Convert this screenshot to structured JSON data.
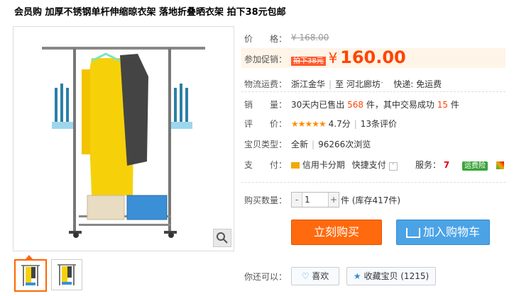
{
  "title": "会员购 加厚不锈钢单杆伸缩晾衣架 落地折叠晒衣架 拍下38元包邮",
  "price": {
    "label": "价　　格：",
    "original": "¥ 168.00"
  },
  "promo": {
    "label": "参加促销：",
    "tag": "拍下38元",
    "yen": "¥",
    "amount": "160.00"
  },
  "shipping": {
    "label": "物流运费：",
    "from": "浙江金华",
    "to_prefix": "至",
    "to": "河北廊坊",
    "fee": "快递: 免运费"
  },
  "sales": {
    "label": "销　　量：",
    "pre": "30天内已售出",
    "count": "568",
    "mid": "件，其中交易成功",
    "success": "15",
    "post": "件"
  },
  "rating": {
    "label": "评　　价：",
    "stars": "★★★★★",
    "score": "4.7分",
    "reviews": "13条评价"
  },
  "item_type": {
    "label": "宝贝类型：",
    "condition": "全新",
    "views": "96266次浏览"
  },
  "payment": {
    "label": "支　　付：",
    "credit": "信用卡分期",
    "quick": "快捷支付",
    "service_label": "服务：",
    "service_num": "7",
    "badge": "运费险"
  },
  "quantity": {
    "label": "购买数量：",
    "minus": "-",
    "value": "1",
    "plus": "+",
    "unit": "件 (库存417件)"
  },
  "actions": {
    "buy": "立刻购买",
    "cart": "加入购物车"
  },
  "social": {
    "label": "你还可以：",
    "like": "喜欢",
    "fav": "收藏宝贝 (1215)"
  },
  "colors": {
    "accent": "#ff4400",
    "buy": "#ff6a0e",
    "cart": "#4ba3e6"
  }
}
